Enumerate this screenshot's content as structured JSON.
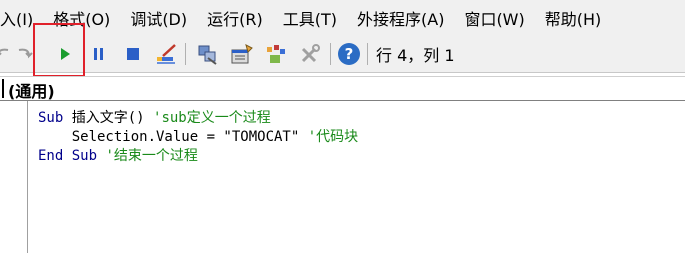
{
  "menu": {
    "items": [
      {
        "label": "入(I)"
      },
      {
        "label": "格式(O)"
      },
      {
        "label": "调试(D)"
      },
      {
        "label": "运行(R)"
      },
      {
        "label": "工具(T)"
      },
      {
        "label": "外接程序(A)"
      },
      {
        "label": "窗口(W)"
      },
      {
        "label": "帮助(H)"
      }
    ]
  },
  "toolbar": {
    "position_text": "行 4，列 1",
    "run_color": "#1a9c2e",
    "highlight_color": "#e0202a"
  },
  "object_combo": {
    "value": "(通用)"
  },
  "code": {
    "line1": {
      "kw": "Sub",
      "text": " 插入文字() ",
      "comment": "'sub定义一个过程"
    },
    "line2": {
      "text": "    Selection.Value = \"TOMOCAT\" ",
      "comment": "'代码块"
    },
    "line3": {
      "kw": "End Sub",
      "text": " ",
      "comment": "'结束一个过程"
    }
  }
}
